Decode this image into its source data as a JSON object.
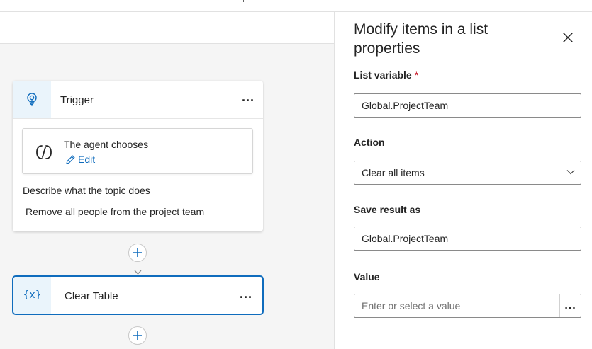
{
  "canvas": {
    "trigger": {
      "title": "Trigger",
      "more_label": "...",
      "agent_card": {
        "title": "The agent chooses",
        "edit_label": "Edit"
      },
      "description_label": "Describe what the topic does",
      "description_value": "Remove all people from the project team"
    },
    "clear_node": {
      "icon_text": "{x}",
      "title": "Clear Table",
      "more_label": "..."
    },
    "add_step_symbol": "+"
  },
  "panel": {
    "title": "Modify items in a list properties",
    "fields": {
      "list_variable": {
        "label": "List variable",
        "required_marker": "*",
        "value": "Global.ProjectTeam"
      },
      "action": {
        "label": "Action",
        "selected": "Clear all items"
      },
      "save_result": {
        "label": "Save result as",
        "value": "Global.ProjectTeam"
      },
      "value": {
        "label": "Value",
        "placeholder": "Enter or select a value",
        "more_label": "..."
      }
    }
  },
  "colors": {
    "accent": "#0f6cbd",
    "icon_bg": "#eaf4fb",
    "canvas_bg": "#f5f5f5",
    "required": "#c50f1f"
  },
  "icons": [
    "lightbulb-trigger-icon",
    "agent-logo-icon",
    "pencil-icon",
    "plus-icon",
    "arrow-down-icon",
    "variable-icon",
    "close-icon",
    "chevron-down-icon"
  ]
}
